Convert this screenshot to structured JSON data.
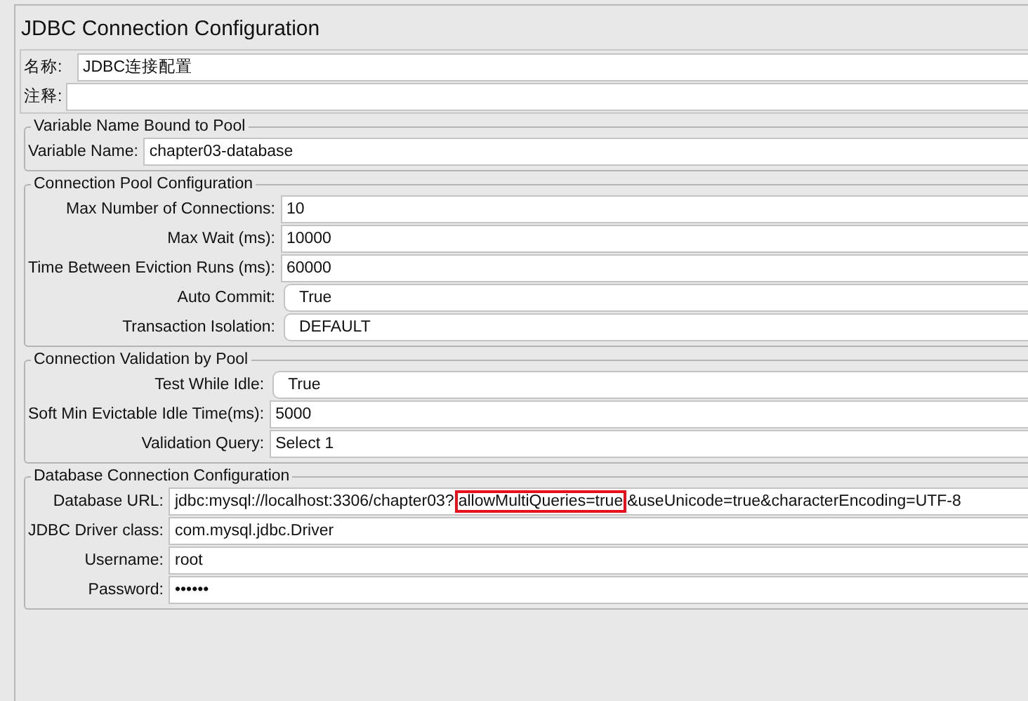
{
  "title": "JDBC Connection Configuration",
  "name_fields": [
    {
      "label": "名称:",
      "value": "JDBC连接配置"
    },
    {
      "label": "注释:"
    }
  ],
  "groups": [
    {
      "title": "Variable Name Bound to Pool",
      "fields": [
        {
          "kind": "text",
          "label": "Variable Name:",
          "value": "chapter03-database"
        }
      ]
    },
    {
      "title": "Connection Pool Configuration",
      "fields": [
        {
          "kind": "text",
          "label": "Max Number of Connections:",
          "value": "10"
        },
        {
          "kind": "text",
          "label": "Max Wait (ms):",
          "value": "10000"
        },
        {
          "kind": "text",
          "label": "Time Between Eviction Runs (ms):",
          "value": "60000"
        },
        {
          "kind": "select",
          "label": "Auto Commit:",
          "value": "True"
        },
        {
          "kind": "select",
          "label": "Transaction Isolation:",
          "value": "DEFAULT"
        }
      ]
    },
    {
      "title": "Connection Validation by Pool",
      "fields": [
        {
          "kind": "select",
          "label": "Test While Idle:",
          "value": "True"
        },
        {
          "kind": "text",
          "label": "Soft Min Evictable Idle Time(ms):",
          "value": "5000"
        },
        {
          "kind": "text",
          "label": "Validation Query:",
          "value": "Select 1"
        }
      ]
    },
    {
      "title": "Database Connection Configuration",
      "fields": [
        {
          "kind": "segmented",
          "label": "Database URL:",
          "segments": [
            {
              "text": "jdbc:mysql://localhost:3306/chapter03?",
              "highlighted": false
            },
            {
              "text": "allowMultiQueries=true",
              "highlighted": true
            },
            {
              "text": "&useUnicode=true&characterEncoding=UTF-8",
              "highlighted": false
            }
          ]
        },
        {
          "kind": "text",
          "label": "JDBC Driver class:",
          "value": "com.mysql.jdbc.Driver"
        },
        {
          "kind": "text",
          "label": "Username:",
          "value": "root"
        },
        {
          "kind": "text",
          "label": "Password:",
          "value": "••••••"
        }
      ]
    }
  ]
}
